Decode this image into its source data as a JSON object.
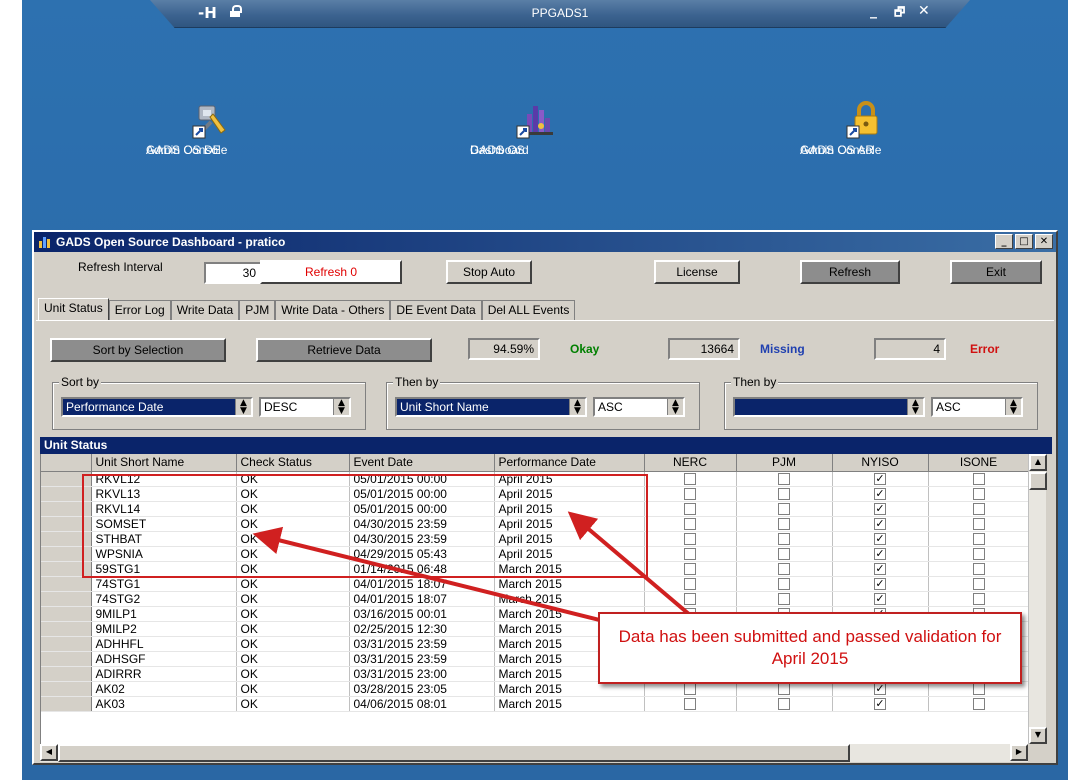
{
  "remote_bar": {
    "title": "PPGADS1",
    "pin_glyph": "-H",
    "controls": [
      "_",
      "🗗",
      "✕"
    ]
  },
  "desktop_icons": [
    {
      "icon": "admin-console-tools-icon",
      "lines": [
        "GADS OS DE",
        "Admin Console"
      ]
    },
    {
      "icon": "dashboard-chart-icon",
      "lines": [
        "GADS OS",
        "Dashboard"
      ]
    },
    {
      "icon": "lock-icon",
      "lines": [
        "GADS OS AR",
        "Admin Console"
      ]
    }
  ],
  "window": {
    "title": "GADS Open Source Dashboard - pratico",
    "buttons": [
      "_",
      "□",
      "✕"
    ]
  },
  "toolbar": {
    "refresh_interval_label": "Refresh Interval",
    "refresh_interval_value": "30",
    "refresh_counter": "Refresh 0",
    "stop_auto": "Stop Auto",
    "license": "License",
    "refresh": "Refresh",
    "exit": "Exit"
  },
  "tabs": [
    "Unit Status",
    "Error Log",
    "Write Data",
    "PJM",
    "Write Data - Others",
    "DE Event Data",
    "Del ALL Events"
  ],
  "stats": {
    "sort_by_selection": "Sort by Selection",
    "retrieve_data": "Retrieve Data",
    "okay_pct": "94.59%",
    "okay_label": "Okay",
    "missing_count": "13664",
    "missing_label": "Missing",
    "error_count": "4",
    "error_label": "Error"
  },
  "sort": {
    "sort_by": {
      "label": "Sort by",
      "field": "Performance Date",
      "order": "DESC"
    },
    "then_by_1": {
      "label": "Then by",
      "field": "Unit Short Name",
      "order": "ASC"
    },
    "then_by_2": {
      "label": "Then by",
      "field": "",
      "order": "ASC"
    }
  },
  "grid": {
    "title": "Unit Status",
    "columns": [
      "Unit Short Name",
      "Check Status",
      "Event Date",
      "Performance Date",
      "NERC",
      "PJM",
      "NYISO",
      "ISONE"
    ],
    "rows": [
      [
        "RKVL12",
        "OK",
        "05/01/2015 00:00",
        "April 2015",
        false,
        false,
        true,
        false
      ],
      [
        "RKVL13",
        "OK",
        "05/01/2015 00:00",
        "April 2015",
        false,
        false,
        true,
        false
      ],
      [
        "RKVL14",
        "OK",
        "05/01/2015 00:00",
        "April 2015",
        false,
        false,
        true,
        false
      ],
      [
        "SOMSET",
        "OK",
        "04/30/2015 23:59",
        "April 2015",
        false,
        false,
        true,
        false
      ],
      [
        "STHBAT",
        "OK",
        "04/30/2015 23:59",
        "April 2015",
        false,
        false,
        true,
        false
      ],
      [
        "WPSNIA",
        "OK",
        "04/29/2015 05:43",
        "April 2015",
        false,
        false,
        true,
        false
      ],
      [
        "59STG1",
        "OK",
        "01/14/2015 06:48",
        "March 2015",
        false,
        false,
        true,
        false
      ],
      [
        "74STG1",
        "OK",
        "04/01/2015 18:07",
        "March 2015",
        false,
        false,
        true,
        false
      ],
      [
        "74STG2",
        "OK",
        "04/01/2015 18:07",
        "March 2015",
        false,
        false,
        true,
        false
      ],
      [
        "9MILP1",
        "OK",
        "03/16/2015 00:01",
        "March 2015",
        false,
        false,
        true,
        false
      ],
      [
        "9MILP2",
        "OK",
        "02/25/2015 12:30",
        "March 2015",
        false,
        false,
        true,
        false
      ],
      [
        "ADHHFL",
        "OK",
        "03/31/2015 23:59",
        "March 2015",
        false,
        false,
        true,
        false
      ],
      [
        "ADHSGF",
        "OK",
        "03/31/2015 23:59",
        "March 2015",
        false,
        false,
        true,
        false
      ],
      [
        "ADIRRR",
        "OK",
        "03/31/2015 23:00",
        "March 2015",
        false,
        false,
        true,
        false
      ],
      [
        "AK02",
        "OK",
        "03/28/2015 23:05",
        "March 2015",
        false,
        false,
        true,
        false
      ],
      [
        "AK03",
        "OK",
        "04/06/2015 08:01",
        "March 2015",
        false,
        false,
        true,
        false
      ]
    ]
  },
  "annotation": {
    "callout_text": "Data has been submitted and passed validation for April 2015",
    "color": "#d01010"
  },
  "colors": {
    "desktop": "#2b6cab",
    "titlebar": "#0a246a",
    "okay": "#008000",
    "missing": "#2040b0",
    "error": "#d01010",
    "refresh_counter": "#e00000"
  }
}
